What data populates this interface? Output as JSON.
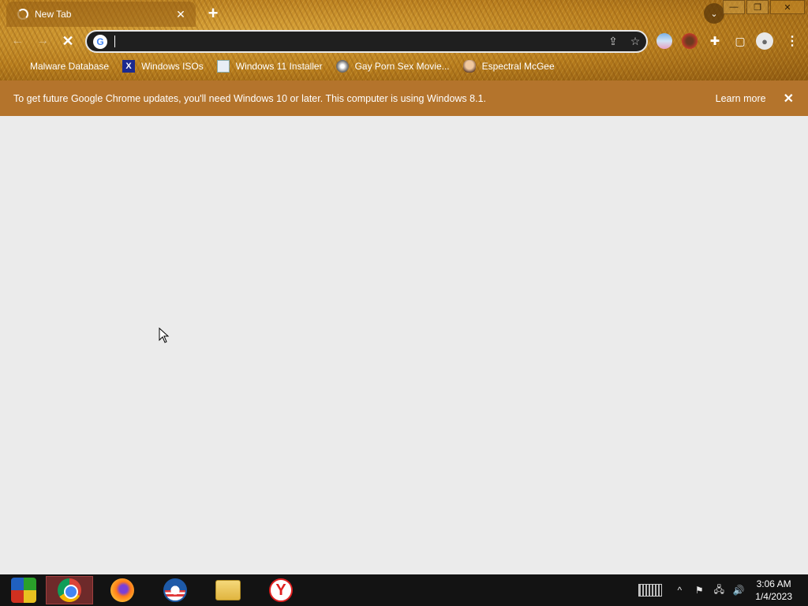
{
  "browser": {
    "tab_title": "New Tab",
    "tab_close": "✕",
    "new_tab": "+",
    "omnibox_value": "",
    "window_controls": {
      "minimize": "—",
      "maximize": "❐",
      "close": "✕"
    }
  },
  "bookmarks": [
    {
      "label": "Malware Database",
      "icon": "leaf-icon"
    },
    {
      "label": "Windows ISOs",
      "icon": "x-logo-icon"
    },
    {
      "label": "Windows 11 Installer",
      "icon": "installer-icon"
    },
    {
      "label": "Gay Porn Sex Movie...",
      "icon": "disc-icon"
    },
    {
      "label": "Espectral McGee",
      "icon": "face-icon"
    }
  ],
  "infobar": {
    "message": "To get future Google Chrome updates, you'll need Windows 10 or later. This computer is using Windows 8.1.",
    "learn_more": "Learn more",
    "close": "✕"
  },
  "taskbar": {
    "apps": [
      "start-icon",
      "chrome-icon",
      "firefox-icon",
      "obama-icon",
      "file-explorer-icon",
      "yandex-icon"
    ],
    "yandex_letter": "Y",
    "time": "3:06 AM",
    "date": "1/4/2023"
  },
  "colors": {
    "infobar": "#b4742c",
    "content_bg": "#ebebeb",
    "taskbar": "#131313",
    "active_taskbar_btn": "#6e2a2a"
  }
}
